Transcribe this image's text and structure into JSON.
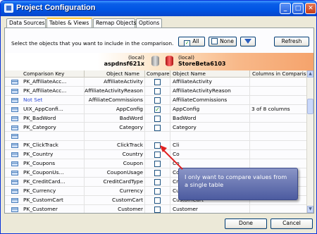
{
  "window": {
    "title": "Project Configuration",
    "minimize": "_",
    "maximize": "□",
    "close": "✕"
  },
  "tabs": [
    {
      "label": "Data Sources"
    },
    {
      "label": "Tables & Views"
    },
    {
      "label": "Remap Objects"
    },
    {
      "label": "Options"
    }
  ],
  "instruction": "Select the objects that you want to include in the comparison.",
  "toolbar": {
    "all_label": "All",
    "none_label": "None",
    "filter_icon": "funnel-icon",
    "refresh_label": "Refresh"
  },
  "source_db": {
    "tag": "(local)",
    "name": "aspdnsf621x"
  },
  "target_db": {
    "tag": "(local)",
    "name": "StoreBeta6103"
  },
  "columns": {
    "key": "Comparison Key",
    "obj": "Object Name",
    "compare": "Compare",
    "obj2": "Object Name",
    "cols": "Columns in Comparison"
  },
  "rows": [
    {
      "key": "PK_AffiliateAcc...",
      "obj": "AffiliateActivity",
      "checked": false,
      "obj2": "AffiliateActivity",
      "cols": ""
    },
    {
      "key": "PK_AffiliateAcc...",
      "obj": "AffiliateActivityReason",
      "checked": false,
      "obj2": "AffiliateActivityReason",
      "cols": ""
    },
    {
      "key": "Not Set",
      "obj": "AffiliateCommissions",
      "checked": false,
      "obj2": "AffiliateCommissions",
      "cols": ""
    },
    {
      "key": "UIX_AppConfi...",
      "obj": "AppConfig",
      "checked": true,
      "obj2": "AppConfig",
      "cols": "3 of 8 columns"
    },
    {
      "key": "PK_BadWord",
      "obj": "BadWord",
      "checked": false,
      "obj2": "BadWord",
      "cols": ""
    },
    {
      "key": "PK_Category",
      "obj": "Category",
      "checked": false,
      "obj2": "Category",
      "cols": ""
    },
    {
      "key": "",
      "obj": "",
      "checked": false,
      "obj2": "",
      "cols": ""
    },
    {
      "key": "PK_ClickTrack",
      "obj": "ClickTrack",
      "checked": false,
      "obj2": "Cli",
      "cols": ""
    },
    {
      "key": "PK_Country",
      "obj": "Country",
      "checked": false,
      "obj2": "Co",
      "cols": ""
    },
    {
      "key": "PK_Coupons",
      "obj": "Coupon",
      "checked": false,
      "obj2": "Co",
      "cols": ""
    },
    {
      "key": "PK_CouponUs...",
      "obj": "CouponUsage",
      "checked": false,
      "obj2": "CouponUsage",
      "cols": ""
    },
    {
      "key": "PK_CreditCard...",
      "obj": "CreditCardType",
      "checked": false,
      "obj2": "CreditCardType",
      "cols": ""
    },
    {
      "key": "PK_Currency",
      "obj": "Currency",
      "checked": false,
      "obj2": "Currency",
      "cols": ""
    },
    {
      "key": "PK_CustomCart",
      "obj": "CustomCart",
      "checked": false,
      "obj2": "CustomCart",
      "cols": ""
    },
    {
      "key": "PK_Customer",
      "obj": "Customer",
      "checked": false,
      "obj2": "Customer",
      "cols": ""
    }
  ],
  "callout": {
    "text": "I only want to compare values from a single table"
  },
  "footer": {
    "done_label": "Done",
    "cancel_label": "Cancel"
  },
  "colors": {
    "accent_tab": "#ffc83c",
    "title_bar": "#0054e3",
    "callout_bg": "#5866a8",
    "arrow": "#e02020"
  }
}
